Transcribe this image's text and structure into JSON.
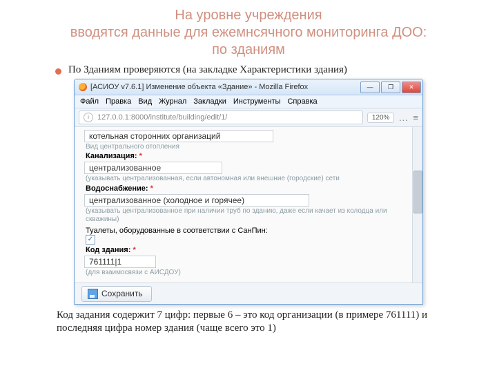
{
  "slide": {
    "title_line1": "На уровне учреждения",
    "title_line2": "вводятся данные для ежемнсячного мониторинга ДОО:",
    "title_line3": "по зданиям",
    "bullet": "По Зданиям проверяются (на закладке Характеристики здания)",
    "footer": "Код задания содержит 7 цифр: первые 6 – это код организации (в примере 761111) и последняя цифра номер здания (чаще всего это 1)"
  },
  "window": {
    "title": "[АСИОУ v7.6.1] Изменение объекта «Здание» - Mozilla Firefox",
    "menus": [
      "Файл",
      "Правка",
      "Вид",
      "Журнал",
      "Закладки",
      "Инструменты",
      "Справка"
    ],
    "url": "127.0.0.1:8000/institute/building/edit/1/",
    "zoom": "120%"
  },
  "form": {
    "heating_value": "котельная сторонних организаций",
    "heating_sub": "Вид центрального отопления",
    "sewer_label": "Канализация:",
    "sewer_value": "централизованное",
    "sewer_hint": "(указывать централизованная, если автономная или внешние (городские) сети",
    "water_label": "Водоснабжение:",
    "water_value": "централизованное (холодное и горячее)",
    "water_hint": "(указывать централизованное при наличии труб по зданию, даже если качает из колодца или скважины)",
    "toilets_label": "Туалеты, оборудованные в соответствии с СанПин:",
    "code_label": "Код здания:",
    "code_value": "761111|1",
    "code_hint": "(для взаимосвязи с АИСДОУ)",
    "save": "Сохранить"
  }
}
